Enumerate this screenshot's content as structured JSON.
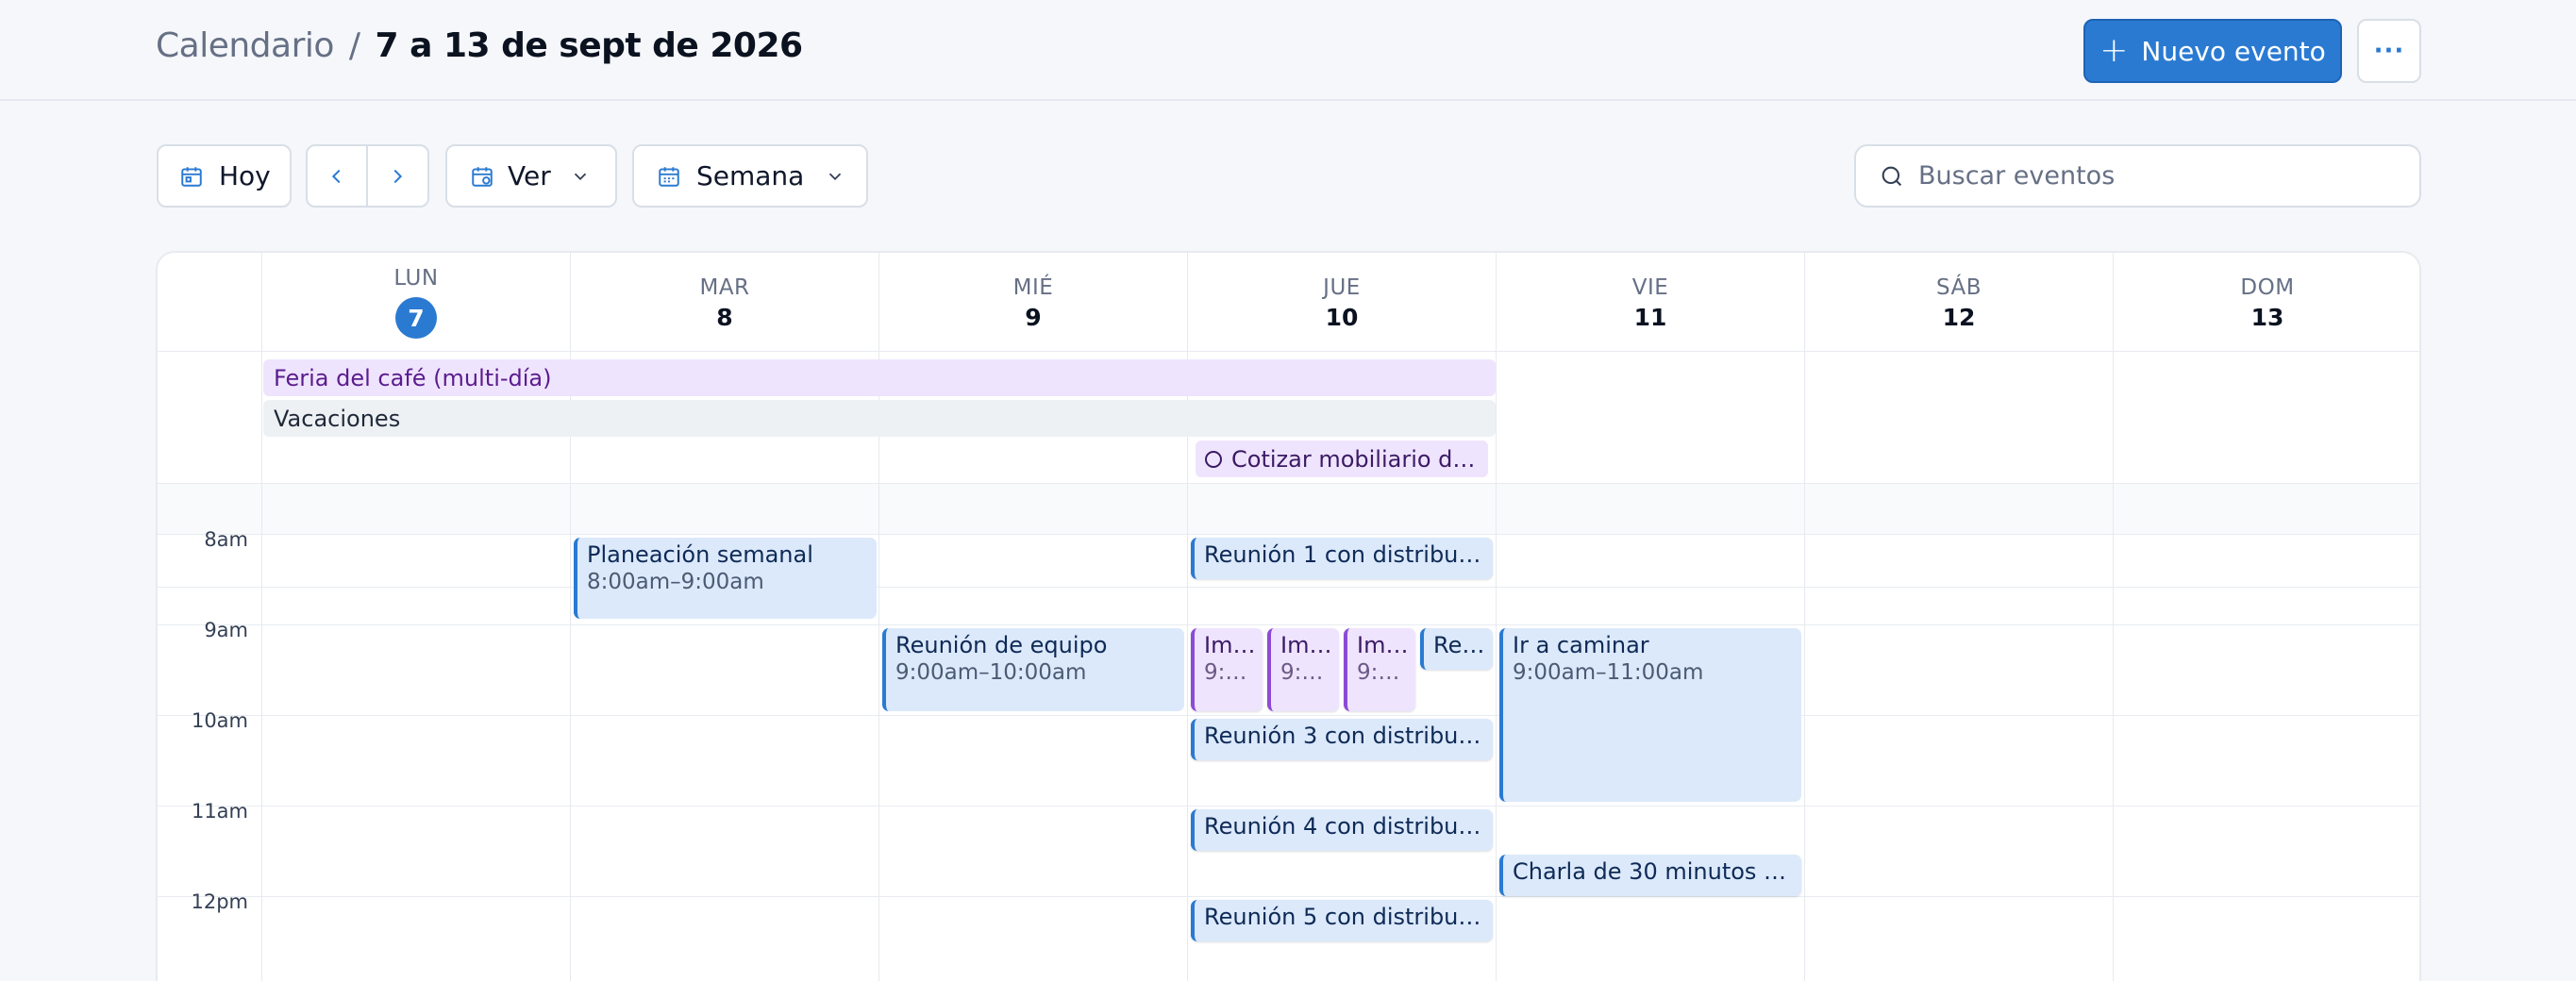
{
  "header": {
    "breadcrumb_root": "Calendario",
    "breadcrumb_sep": "/",
    "breadcrumb_current": "7 a 13 de sept de 2026",
    "new_event_label": "Nuevo evento",
    "more_label": "···"
  },
  "toolbar": {
    "today_label": "Hoy",
    "view_label": "Ver",
    "range_label": "Semana",
    "search_placeholder": "Buscar eventos"
  },
  "days": [
    {
      "name": "LUN",
      "num": "7",
      "today": true
    },
    {
      "name": "MAR",
      "num": "8"
    },
    {
      "name": "MIÉ",
      "num": "9"
    },
    {
      "name": "JUE",
      "num": "10"
    },
    {
      "name": "VIE",
      "num": "11"
    },
    {
      "name": "SÁB",
      "num": "12"
    },
    {
      "name": "DOM",
      "num": "13"
    }
  ],
  "all_day": {
    "feria": "Feria del café (multi-día)",
    "vacaciones": "Vacaciones",
    "task": "Cotizar mobiliario de …"
  },
  "times": [
    "8am",
    "9am",
    "10am",
    "11am",
    "12pm"
  ],
  "events": {
    "planeacion_title": "Planeación semanal",
    "planeacion_time": "8:00am–9:00am",
    "reunion_equipo_title": "Reunión de equipo",
    "reunion_equipo_time": "9:00am–10:00am",
    "reunion1_title": "Reunión 1 con distribuid…",
    "im1_title": "Im…",
    "im1_time": "9:0…",
    "im2_title": "Im…",
    "im2_time": "9:0…",
    "im3_title": "Im…",
    "im3_time": "9:0…",
    "re_title": "Re…",
    "reunion3_title": "Reunión 3 con distribuid…",
    "reunion4_title": "Reunión 4 con distribuid…",
    "reunion5_title": "Reunión 5 con distribuid…",
    "caminar_title": "Ir a caminar",
    "caminar_time": "9:00am–11:00am",
    "charla_title": "Charla de 30 minutos — …"
  },
  "colors": {
    "accent": "#2a7ad2",
    "event_blue_bg": "#dce9fb",
    "event_purple_bg": "#efe4fd",
    "event_purple_border": "#8c4bd6"
  }
}
